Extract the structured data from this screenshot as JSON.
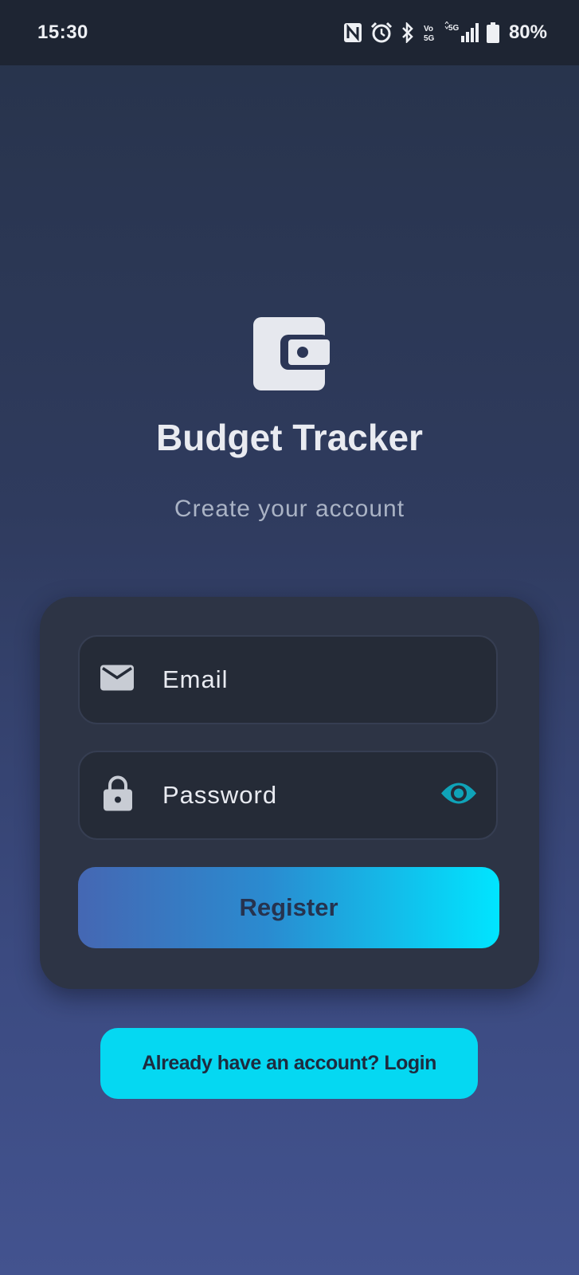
{
  "status_bar": {
    "time": "15:30",
    "battery": "80%",
    "icons": [
      "nfc-icon",
      "alarm-icon",
      "bluetooth-icon",
      "volte-icon",
      "signal-5g-icon",
      "battery-icon"
    ]
  },
  "header": {
    "logo_icon": "wallet-icon",
    "title": "Budget Tracker",
    "subtitle": "Create your account"
  },
  "form": {
    "email": {
      "icon": "mail-icon",
      "placeholder": "Email",
      "value": ""
    },
    "password": {
      "icon": "lock-icon",
      "placeholder": "Password",
      "value": "",
      "toggle_icon": "eye-icon"
    },
    "register_label": "Register"
  },
  "footer": {
    "login_label": "Already have an account? Login"
  },
  "colors": {
    "accent": "#00e5ff",
    "card": "#2d3445",
    "field": "#252b37",
    "eye": "#0fa3b8"
  }
}
